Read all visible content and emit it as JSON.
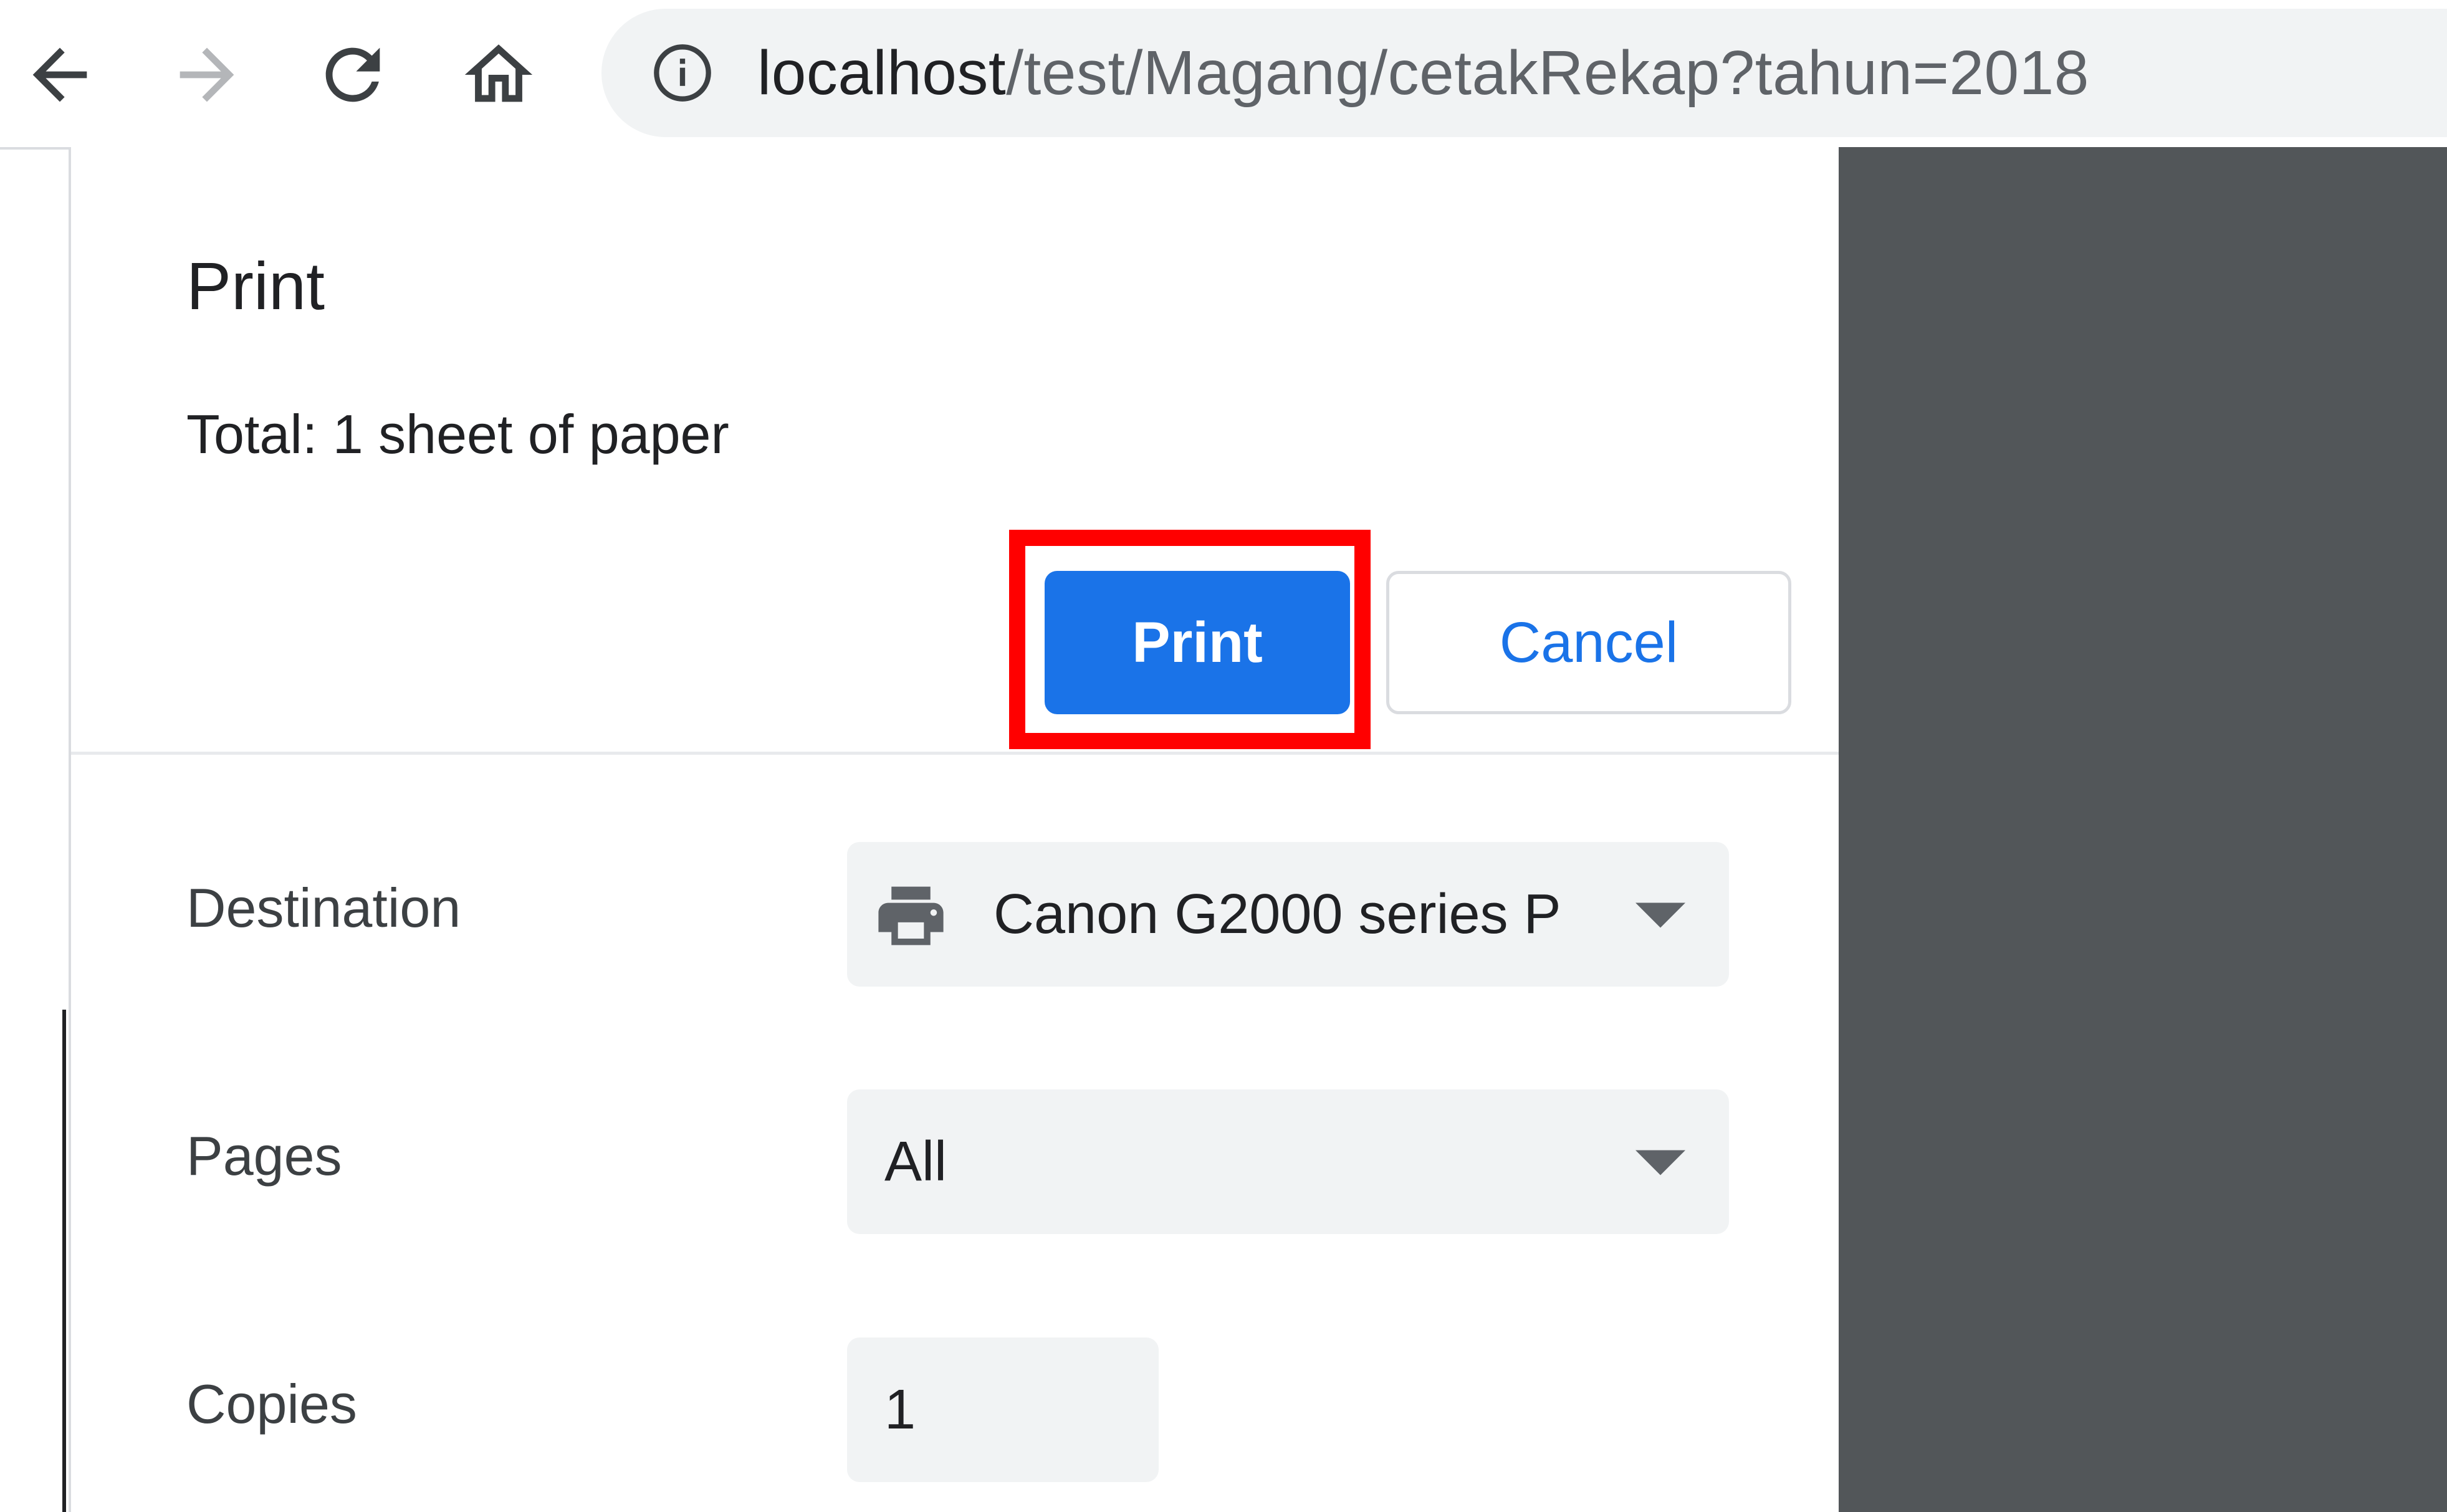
{
  "browser": {
    "url_host": "localhost",
    "url_path": "/test/Magang/cetakRekap?tahun=2018",
    "icons": [
      "back-icon",
      "forward-icon",
      "reload-icon",
      "home-icon",
      "info-icon"
    ]
  },
  "dialog": {
    "title": "Print",
    "summary": "Total: 1 sheet of paper",
    "print_button": "Print",
    "cancel_button": "Cancel",
    "destination_label": "Destination",
    "destination_value": "Canon G2000 series P",
    "pages_label": "Pages",
    "pages_value": "All",
    "copies_label": "Copies",
    "copies_value": "1"
  },
  "colors": {
    "accent": "#1a73e8",
    "highlight": "#ff0000",
    "preview_bg": "#525659"
  }
}
